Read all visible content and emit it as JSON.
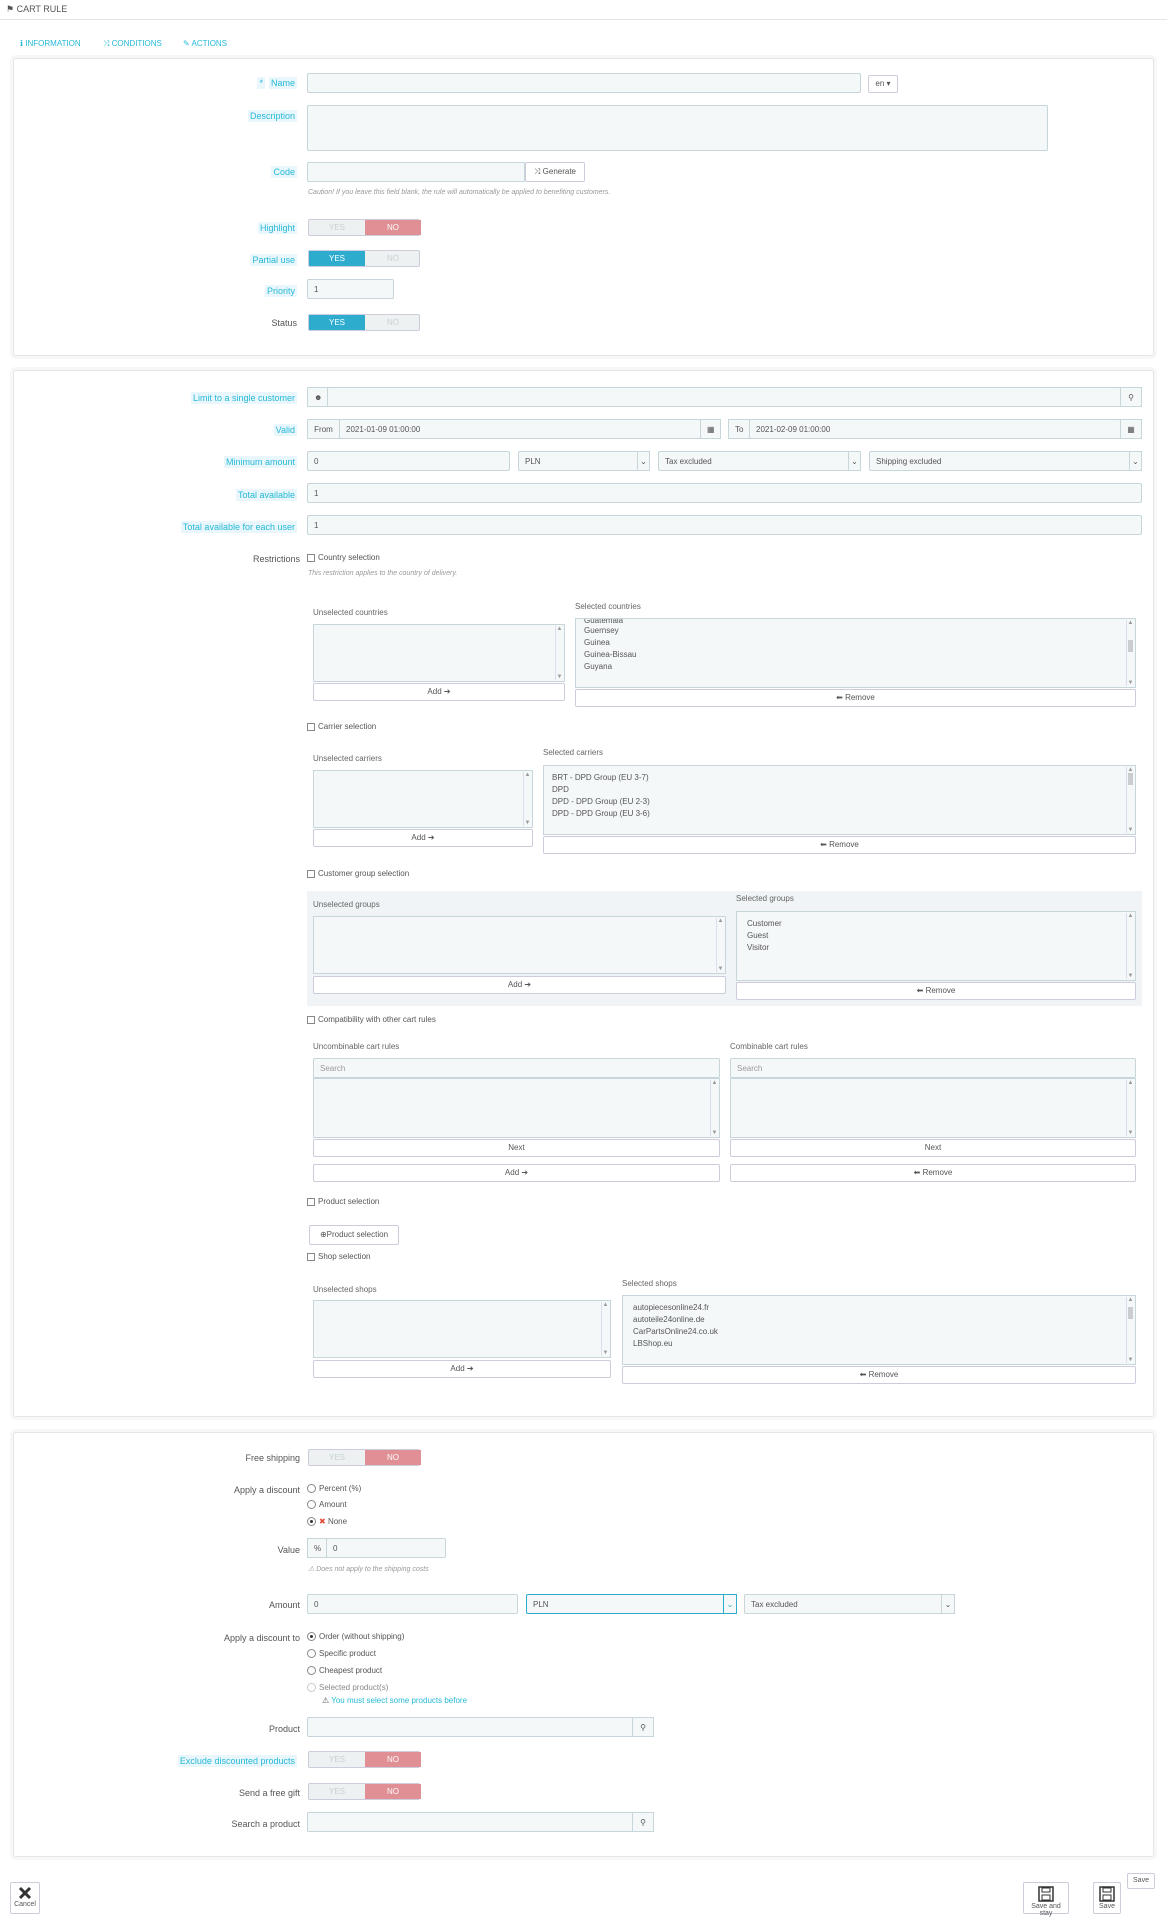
{
  "header": {
    "title": "CART RULE"
  },
  "tabs": [
    {
      "icon": "info-icon",
      "label": "INFORMATION"
    },
    {
      "icon": "shuffle-icon",
      "label": "CONDITIONS"
    },
    {
      "icon": "wrench-icon",
      "label": "ACTIONS"
    }
  ],
  "info": {
    "name_label": "Name",
    "name_value": "",
    "lang": "en",
    "description_label": "Description",
    "code_label": "Code",
    "generate_label": "Generate",
    "code_help": "Caution! If you leave this field blank, the rule will automatically be applied to benefiting customers.",
    "highlight_label": "Highlight",
    "partial_label": "Partial use",
    "priority_label": "Priority",
    "priority_value": "1",
    "status_label": "Status",
    "yes": "YES",
    "no": "NO"
  },
  "conditions": {
    "limit_label": "Limit to a single customer",
    "valid_label": "Valid",
    "from_label": "From",
    "from_value": "2021-01-09 01:00:00",
    "to_label": "To",
    "to_value": "2021-02-09 01:00:00",
    "min_amount_label": "Minimum amount",
    "min_amount_value": "0",
    "currency": "PLN",
    "tax": "Tax excluded",
    "shipping": "Shipping excluded",
    "total_label": "Total available",
    "total_value": "1",
    "each_user_label": "Total available for each user",
    "each_user_value": "1",
    "restrictions_label": "Restrictions",
    "country_selection": "Country selection",
    "country_help": "This restriction applies to the country of delivery.",
    "unselected_countries": "Unselected countries",
    "selected_countries": "Selected countries",
    "countries": [
      "Guatemala",
      "Guernsey",
      "Guinea",
      "Guinea-Bissau",
      "Guyana"
    ],
    "add": "Add",
    "remove": "Remove",
    "carrier_selection": "Carrier selection",
    "unselected_carriers": "Unselected carriers",
    "selected_carriers": "Selected carriers",
    "carriers": [
      "BRT - DPD Group (EU 3-7)",
      "DPD",
      "DPD - DPD Group (EU 2-3)",
      "DPD - DPD Group (EU 3-6)"
    ],
    "group_selection": "Customer group selection",
    "unselected_groups": "Unselected groups",
    "selected_groups": "Selected groups",
    "groups": [
      "Customer",
      "Guest",
      "Visitor"
    ],
    "compat_label": "Compatibility with other cart rules",
    "uncombinable": "Uncombinable cart rules",
    "combinable": "Combinable cart rules",
    "search": "Search",
    "next": "Next",
    "product_selection": "Product selection",
    "product_selection_btn": "Product selection",
    "shop_selection": "Shop selection",
    "unselected_shops": "Unselected shops",
    "selected_shops": "Selected shops",
    "shops": [
      "autopiecesonline24.fr",
      "autoteile24online.de",
      "CarPartsOnline24.co.uk",
      "LBShop.eu"
    ]
  },
  "actions": {
    "free_shipping_label": "Free shipping",
    "apply_discount_label": "Apply a discount",
    "percent": "Percent (%)",
    "amount_opt": "Amount",
    "none": "None",
    "value_label": "Value",
    "percent_sign": "%",
    "value": "0",
    "value_help": "Does not apply to the shipping costs",
    "amount_label": "Amount",
    "amount_value": "0",
    "currency": "PLN",
    "tax": "Tax excluded",
    "apply_to_label": "Apply a discount to",
    "order": "Order (without shipping)",
    "specific": "Specific product",
    "cheapest": "Cheapest product",
    "selected": "Selected product(s)",
    "selected_warning": "You must select some products before",
    "product_label": "Product",
    "exclude_label": "Exclude discounted products",
    "gift_label": "Send a free gift",
    "search_product_label": "Search a product"
  },
  "footer": {
    "cancel": "Cancel",
    "save_stay": "Save and stay",
    "save": "Save",
    "save_tooltip": "Save"
  },
  "colors": {
    "accent": "#25b9d7",
    "yes_on": "#2eacce",
    "no_on": "#e08f95"
  }
}
